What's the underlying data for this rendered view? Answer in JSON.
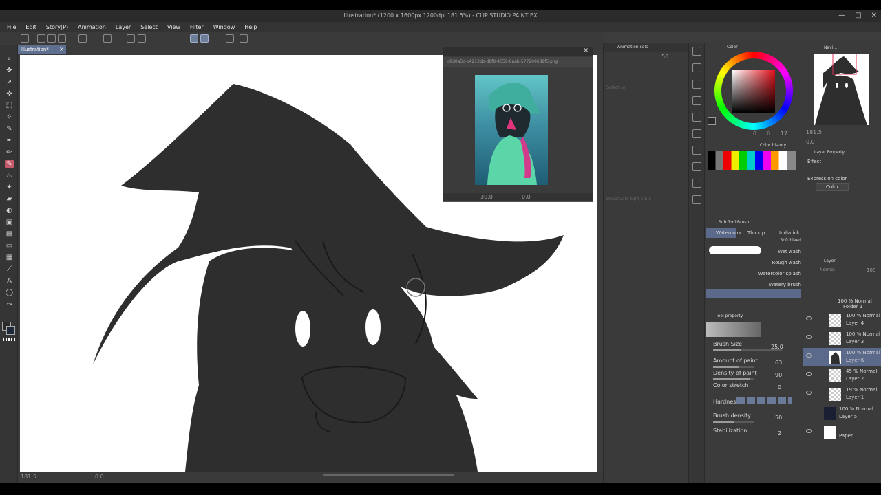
{
  "window": {
    "title": "Illustration* (1200 x 1600px 1200dpi 181.5%) - CLIP STUDIO PAINT EX",
    "controls": [
      "—",
      "□",
      "✕"
    ]
  },
  "menu": [
    "File",
    "Edit",
    "Story(P)",
    "Animation",
    "Layer",
    "Select",
    "View",
    "Filter",
    "Window",
    "Help"
  ],
  "document_tab": {
    "label": "Illustration*",
    "close": "×"
  },
  "canvas_status": {
    "zoom": "181.5",
    "angle": "0.0"
  },
  "subview": {
    "path": "c8d0a5c-b4213bb-d8f8-4559-8aab-5772006d9f5.png",
    "zoom": "30.0",
    "angle": "0.0"
  },
  "animation_cels": {
    "title": "Animation cels",
    "value": "50",
    "hint": "Select cel",
    "hint2": "Deactivate light table"
  },
  "color_panel": {
    "title": "Color",
    "values": [
      "0",
      "0",
      "17"
    ],
    "main_color": "#2b2b2b",
    "sub_color": "#1e2a3c"
  },
  "color_history": {
    "title": "Color history"
  },
  "navigator": {
    "title": "Navi...",
    "zoom": "181.5",
    "angle": "0.0"
  },
  "layer_property": {
    "title": "Layer Property",
    "effect_label": "Effect",
    "expression_label": "Expression color",
    "expression_value": "Color"
  },
  "sub_tool": {
    "title": "Sub Tool:Brush",
    "tabs": [
      "Watercolor",
      "Thick p...",
      "India ink"
    ],
    "brushes": [
      "Soft bleed",
      "Wet wash",
      "Rough wash",
      "Watercolor splash",
      "Watery brush"
    ]
  },
  "tool_property": {
    "title": "Tool property",
    "props": [
      {
        "label": "Brush Size",
        "value": "25.0"
      },
      {
        "label": "Amount of paint",
        "value": "63"
      },
      {
        "label": "Density of paint",
        "value": "90"
      },
      {
        "label": "Color stretch",
        "value": "0"
      },
      {
        "label": "Hardness",
        "value": ""
      },
      {
        "label": "Brush density",
        "value": "50"
      },
      {
        "label": "Stabilization",
        "value": "2"
      }
    ]
  },
  "layer_panel": {
    "title": "Layer",
    "blend": "Normal",
    "opacity": "100",
    "layers": [
      {
        "line1": "100 % Normal",
        "line2": "Folder 1"
      },
      {
        "line1": "100 % Normal",
        "line2": "Layer 4"
      },
      {
        "line1": "100 % Normal",
        "line2": "Layer 3"
      },
      {
        "line1": "100 % Normal",
        "line2": "Layer 6"
      },
      {
        "line1": "45 % Normal",
        "line2": "Layer 2"
      },
      {
        "line1": "19 % Normal",
        "line2": "Layer 1"
      },
      {
        "line1": "100 % Normal",
        "line2": "Layer 5"
      },
      {
        "line1": "",
        "line2": "Paper"
      }
    ]
  },
  "colors": {
    "accent": "#5b6a8a",
    "active_tool": "#c45a6a",
    "ink": "#2e2e2e"
  }
}
